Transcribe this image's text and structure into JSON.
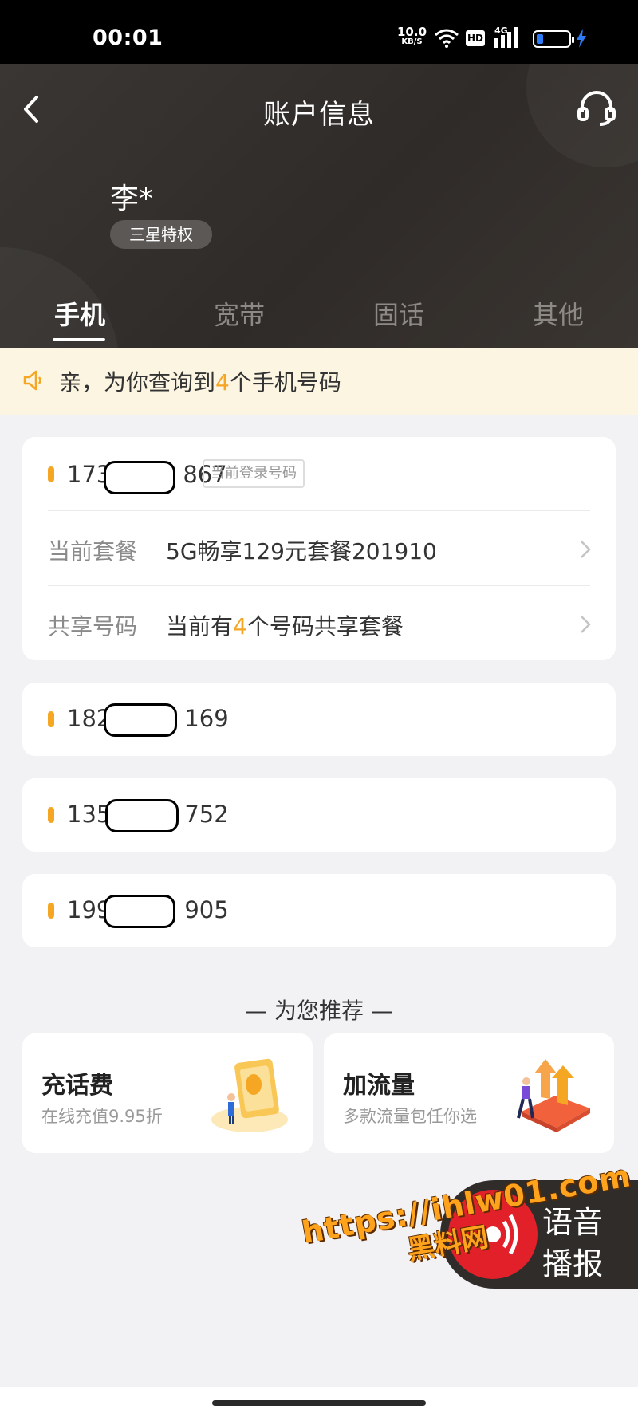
{
  "status_bar": {
    "time": "00:01",
    "speed_value": "10.0",
    "speed_unit": "KB/S",
    "hd": "HD",
    "network": "4G",
    "colors": {
      "battery": "#2d7cf6"
    }
  },
  "header": {
    "title": "账户信息",
    "user_name": "李*",
    "member_badge": "三星特权",
    "icons": {
      "back": "back-arrow-icon",
      "service": "headset-icon"
    }
  },
  "tabs": [
    {
      "label": "手机",
      "active": true
    },
    {
      "label": "宽带",
      "active": false
    },
    {
      "label": "固话",
      "active": false
    },
    {
      "label": "其他",
      "active": false
    }
  ],
  "notice": {
    "prefix": "亲，为你查询到",
    "count": "4",
    "suffix": "个手机号码"
  },
  "numbers": [
    {
      "prefix": "173",
      "suffix": "867",
      "tag": "当前登录号码",
      "plan_label": "当前套餐",
      "plan_value": "5G畅享129元套餐201910",
      "share_label": "共享号码",
      "share_prefix": "当前有",
      "share_count": "4",
      "share_suffix": "个号码共享套餐"
    },
    {
      "prefix": "182",
      "suffix": "169"
    },
    {
      "prefix": "135",
      "suffix": "752"
    },
    {
      "prefix": "199",
      "suffix": "905"
    }
  ],
  "recommend": {
    "title": "— 为您推荐 —",
    "items": [
      {
        "title": "充话费",
        "subtitle": "在线充值9.95折"
      },
      {
        "title": "加流量",
        "subtitle": "多款流量包任你选"
      }
    ]
  },
  "voice_button": {
    "line1": "语音",
    "line2": "播报"
  },
  "watermark": {
    "line1": "https://ihlw01.com",
    "line2": "黑料网"
  },
  "colors": {
    "accent": "#f5a623",
    "header_bg": "#332f2c",
    "voice_red": "#e1202a"
  }
}
